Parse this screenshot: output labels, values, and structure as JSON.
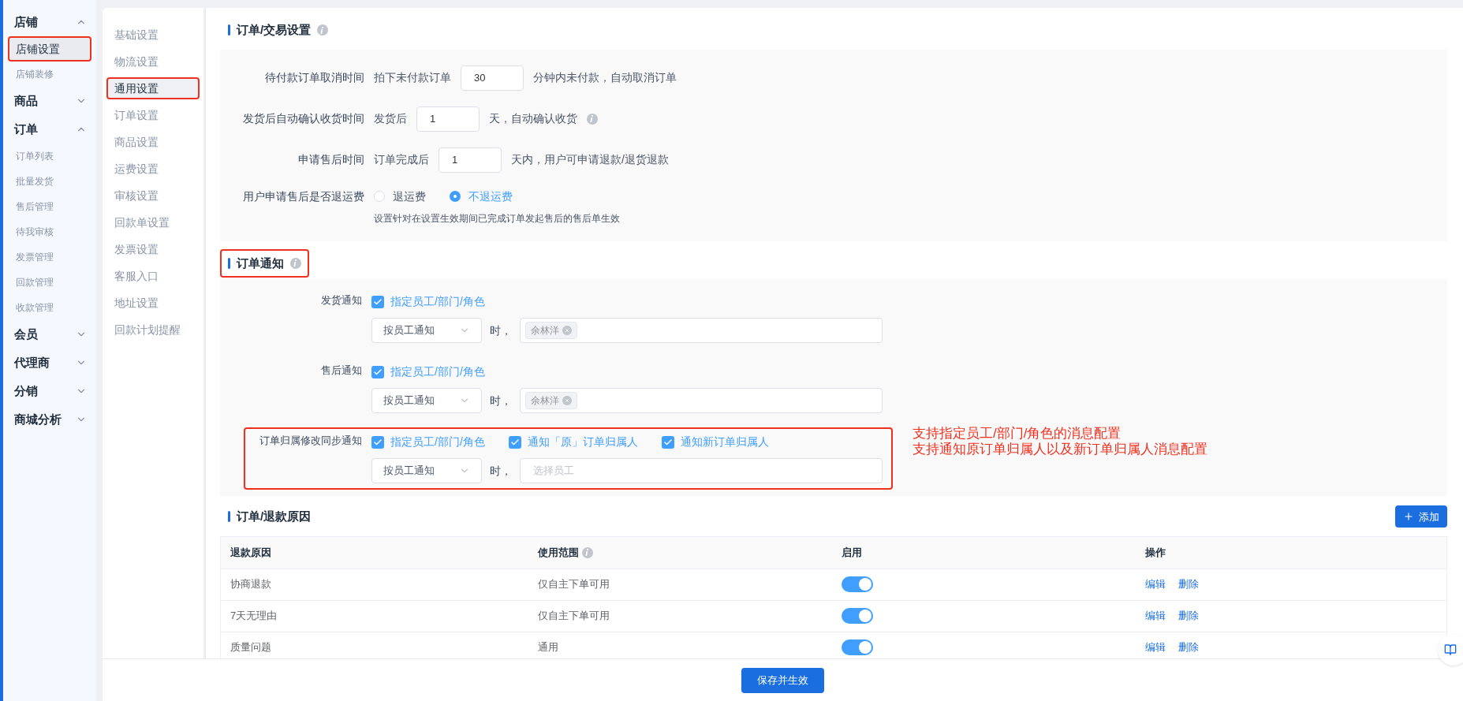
{
  "sidebar": {
    "groups": [
      {
        "label": "店铺",
        "expanded": true,
        "items": [
          {
            "label": "店铺设置",
            "selected": true,
            "highlighted": true
          },
          {
            "label": "店铺装修",
            "selected": false,
            "highlighted": false
          }
        ]
      },
      {
        "label": "商品",
        "expanded": false
      },
      {
        "label": "订单",
        "expanded": true,
        "items": [
          {
            "label": "订单列表",
            "selected": false,
            "highlighted": false
          },
          {
            "label": "批量发货",
            "selected": false,
            "highlighted": false
          },
          {
            "label": "售后管理",
            "selected": false,
            "highlighted": false
          },
          {
            "label": "待我审核",
            "selected": false,
            "highlighted": false
          },
          {
            "label": "发票管理",
            "selected": false,
            "highlighted": false
          },
          {
            "label": "回款管理",
            "selected": false,
            "highlighted": false
          },
          {
            "label": "收款管理",
            "selected": false,
            "highlighted": false
          }
        ]
      },
      {
        "label": "会员",
        "expanded": false
      },
      {
        "label": "代理商",
        "expanded": false
      },
      {
        "label": "分销",
        "expanded": false
      },
      {
        "label": "商城分析",
        "expanded": false
      }
    ]
  },
  "subnav": {
    "items": [
      {
        "label": "基础设置",
        "selected": false,
        "highlighted": false
      },
      {
        "label": "物流设置",
        "selected": false,
        "highlighted": false
      },
      {
        "label": "通用设置",
        "selected": true,
        "highlighted": true
      },
      {
        "label": "订单设置",
        "selected": false,
        "highlighted": false
      },
      {
        "label": "商品设置",
        "selected": false,
        "highlighted": false
      },
      {
        "label": "运费设置",
        "selected": false,
        "highlighted": false
      },
      {
        "label": "审核设置",
        "selected": false,
        "highlighted": false
      },
      {
        "label": "回款单设置",
        "selected": false,
        "highlighted": false
      },
      {
        "label": "发票设置",
        "selected": false,
        "highlighted": false
      },
      {
        "label": "客服入口",
        "selected": false,
        "highlighted": false
      },
      {
        "label": "地址设置",
        "selected": false,
        "highlighted": false
      },
      {
        "label": "回款计划提醒",
        "selected": false,
        "highlighted": false
      }
    ]
  },
  "order_settings": {
    "title": "订单/交易设置",
    "info": true,
    "rows": [
      {
        "kind": "input",
        "label": "待付款订单取消时间",
        "prefix": "拍下未付款订单",
        "value": "30",
        "suffix": "分钟内未付款，自动取消订单"
      },
      {
        "kind": "input",
        "label": "发货后自动确认收货时间",
        "prefix": "发货后",
        "value": "1",
        "suffix": "天，自动确认收货",
        "info": true
      },
      {
        "kind": "input",
        "label": "申请售后时间",
        "prefix": "订单完成后",
        "value": "1",
        "suffix": "天内，用户可申请退款/退货退款"
      },
      {
        "kind": "radio",
        "label": "用户申请售后是否退运费",
        "options": [
          {
            "label": "退运费",
            "selected": false
          },
          {
            "label": "不退运费",
            "selected": true
          }
        ],
        "note": "设置针对在设置生效期间已完成订单发起售后的售后单生效"
      }
    ]
  },
  "notifications": {
    "title": "订单通知",
    "info": true,
    "highlighted": true,
    "rows": [
      {
        "label": "发货通知",
        "checks": [
          {
            "label": "指定员工/部门/角色",
            "checked": true
          }
        ],
        "select": "按员工通知",
        "separator": "时，",
        "tags": [
          "余林洋"
        ]
      },
      {
        "label": "售后通知",
        "checks": [
          {
            "label": "指定员工/部门/角色",
            "checked": true
          }
        ],
        "select": "按员工通知",
        "separator": "时，",
        "tags": [
          "余林洋"
        ]
      },
      {
        "label": "订单归属修改同步通知",
        "highlighted": true,
        "checks": [
          {
            "label": "指定员工/部门/角色",
            "checked": true
          },
          {
            "label": "通知「原」订单归属人",
            "checked": true
          },
          {
            "label": "通知新订单归属人",
            "checked": true
          }
        ],
        "select": "按员工通知",
        "separator": "时，",
        "placeholder": "选择员工"
      }
    ]
  },
  "annotation": [
    "支持指定员工/部门/角色的消息配置",
    "支持通知原订单归属人以及新订单归属人消息配置"
  ],
  "refund_reasons": {
    "title": "订单/退款原因",
    "add_button": "添加",
    "columns": [
      {
        "label": "退款原因"
      },
      {
        "label": "使用范围",
        "info": true
      },
      {
        "label": "启用"
      },
      {
        "label": "操作"
      }
    ],
    "rows": [
      {
        "reason": "协商退款",
        "scope": "仅自主下单可用",
        "enabled": true,
        "actions": [
          "编辑",
          "删除"
        ]
      },
      {
        "reason": "7天无理由",
        "scope": "仅自主下单可用",
        "enabled": true,
        "actions": [
          "编辑",
          "删除"
        ]
      },
      {
        "reason": "质量问题",
        "scope": "通用",
        "enabled": true,
        "actions": [
          "编辑",
          "删除"
        ]
      }
    ]
  },
  "save_button": "保存并生效"
}
